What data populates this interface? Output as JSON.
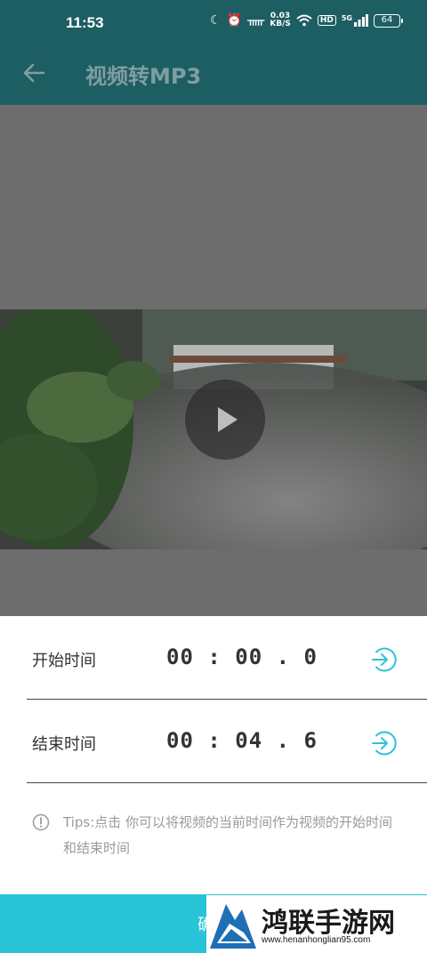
{
  "status_bar": {
    "time": "11:53",
    "net_speed_value": "0.03",
    "net_speed_unit": "KB/S",
    "hd_badge": "HD",
    "network_type": "5G",
    "battery": "64"
  },
  "app_bar": {
    "title": "视频转MP3",
    "back_icon": "arrow-left-icon"
  },
  "video": {
    "play_icon": "play-icon"
  },
  "panel": {
    "rows": [
      {
        "label": "开始时间",
        "value": "00 : 00 . 0",
        "action_icon": "arrow-right-circle-icon"
      },
      {
        "label": "结束时间",
        "value": "00 : 04 . 6",
        "action_icon": "arrow-right-circle-icon"
      }
    ],
    "tips_text": "Tips:点击    你可以将视频的当前时间作为视频的开始时间和结束时间"
  },
  "action": {
    "label": "确"
  },
  "watermark": {
    "text": "鸿联手游网",
    "url": "www.henanhonglian95.com"
  },
  "colors": {
    "app_bar": "#1d5e63",
    "accent": "#29c3d8",
    "video_bg": "#6d6d6d"
  }
}
